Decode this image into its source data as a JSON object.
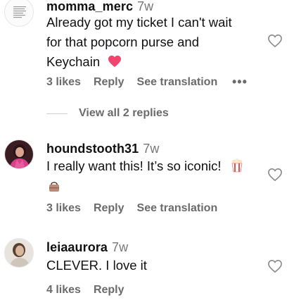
{
  "comments": [
    {
      "username": "momma_merc",
      "time": "7w",
      "text_line1": "Already got my ticket I can't wait",
      "text_line2": "for that popcorn purse and",
      "text_line3": "Keychain",
      "emoji": "heart-emoji",
      "likes": "3 likes",
      "reply": "Reply",
      "translation": "See translation",
      "more": "•••",
      "avatar_icon": "document-thumbnail-avatar"
    },
    {
      "username": "houndstooth31",
      "time": "7w",
      "text_line1": "I really want this! It’s so iconic!",
      "emoji1": "popcorn-emoji",
      "emoji2": "handbag-emoji",
      "likes": "3 likes",
      "reply": "Reply",
      "translation": "See translation",
      "avatar_icon": "person-pink-outfit-avatar"
    },
    {
      "username": "leiaaurora",
      "time": "7w",
      "text_line1": "CLEVER. I love it",
      "likes": "4 likes",
      "reply": "Reply",
      "avatar_icon": "person-portrait-avatar"
    }
  ],
  "view_replies": "View all 2 replies",
  "colors": {
    "heart_fill": "#f0466e",
    "meta_text": "#6b6b6b"
  }
}
